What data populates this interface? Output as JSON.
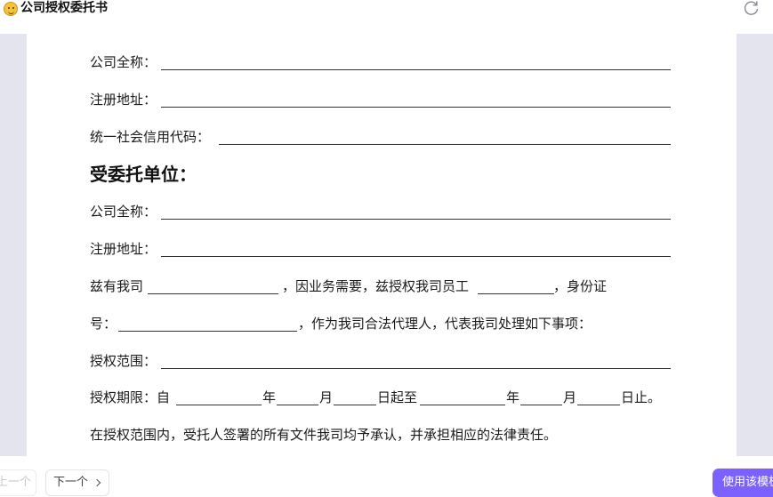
{
  "app": {
    "title": "公司授权委托书",
    "icon": "smiley-icon",
    "refresh_icon": "refresh-icon"
  },
  "document": {
    "principal": {
      "company_name_label": "公司全称：",
      "address_label": "注册地址：",
      "credit_code_label": "统一社会信用代码："
    },
    "agent_heading": "受委托单位：",
    "agent": {
      "company_name_label": "公司全称：",
      "address_label": "注册地址："
    },
    "para1": {
      "a": "兹有我司",
      "b": "，因业务需要，兹授权我司员工",
      "c": "，身份证"
    },
    "para2": {
      "a": "号：",
      "b": "，作为我司合法代理人，代表我司处理如下事项："
    },
    "scope_label": "授权范围：",
    "period": {
      "label": "授权期限：自",
      "year1": "年",
      "month1": "月",
      "from": "日起至",
      "year2": "年",
      "month2": "月",
      "until": "日止。"
    },
    "closing": "在授权范围内，受托人签署的所有文件我司均予承认，并承担相应的法律责任。"
  },
  "footer": {
    "prev_label": "上一个",
    "next_label": "下一个",
    "use_template_label": "使用该模板"
  },
  "colors": {
    "accent": "#7b61ff",
    "preview_bg": "#e3e4ee"
  }
}
